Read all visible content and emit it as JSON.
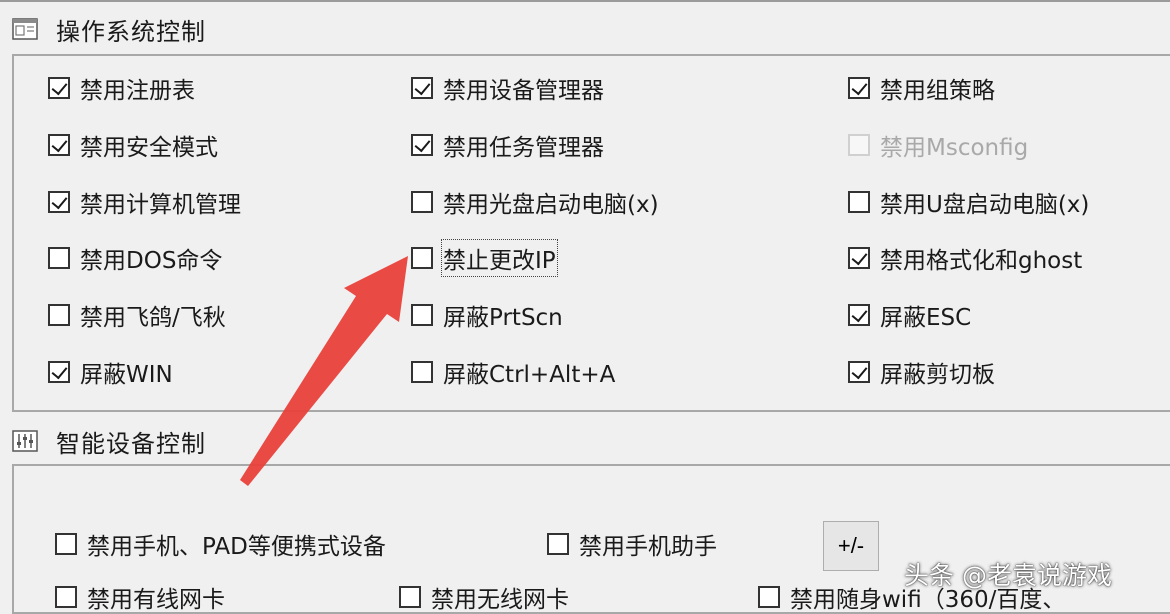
{
  "os_section": {
    "title": "操作系统控制",
    "icon": "window-panel-icon",
    "items": [
      {
        "label": "禁用注册表",
        "checked": true
      },
      {
        "label": "禁用设备管理器",
        "checked": true
      },
      {
        "label": "禁用组策略",
        "checked": true
      },
      {
        "label": "禁用安全模式",
        "checked": true
      },
      {
        "label": "禁用任务管理器",
        "checked": true
      },
      {
        "label": "禁用Msconfig",
        "checked": false,
        "disabled": true
      },
      {
        "label": "禁用计算机管理",
        "checked": true
      },
      {
        "label": "禁用光盘启动电脑(x)",
        "checked": false
      },
      {
        "label": "禁用U盘启动电脑(x)",
        "checked": false
      },
      {
        "label": "禁用DOS命令",
        "checked": false
      },
      {
        "label": "禁止更改IP",
        "checked": false,
        "focused": true
      },
      {
        "label": "禁用格式化和ghost",
        "checked": true
      },
      {
        "label": "禁用飞鸽/飞秋",
        "checked": false
      },
      {
        "label": "屏蔽PrtScn",
        "checked": false
      },
      {
        "label": "屏蔽ESC",
        "checked": true
      },
      {
        "label": "屏蔽WIN",
        "checked": true
      },
      {
        "label": "屏蔽Ctrl+Alt+A",
        "checked": false
      },
      {
        "label": "屏蔽剪切板",
        "checked": true
      }
    ]
  },
  "device_section": {
    "title": "智能设备控制",
    "icon": "sliders-icon",
    "items": [
      {
        "label": "禁用手机、PAD等便携式设备",
        "checked": false
      },
      {
        "label": "禁用手机助手",
        "checked": false
      },
      {
        "label": "禁用有线网卡",
        "checked": false
      },
      {
        "label": "禁用无线网卡",
        "checked": false
      },
      {
        "label": "禁用随身wifi（360/百度、",
        "checked": false
      }
    ],
    "plus_minus_label": "+/-"
  },
  "watermark": "头条 @老袁说游戏",
  "colors": {
    "annotation_arrow": "#e8403a",
    "group_border": "#a8a8a8",
    "background": "#f0f0f0"
  }
}
